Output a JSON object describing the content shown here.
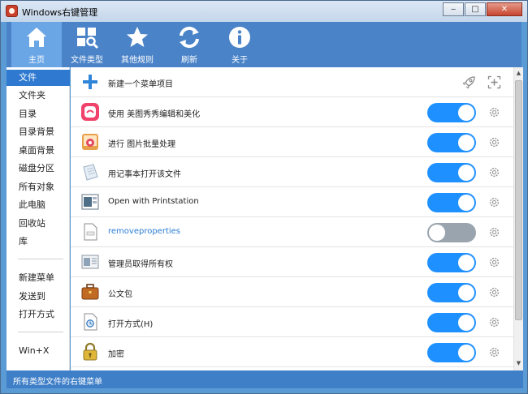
{
  "window": {
    "title": "Windows右键管理"
  },
  "colors": {
    "accent": "#2f7ad0",
    "toolbar": "#4a83c8",
    "toggle_on": "#1e90ff",
    "toggle_off": "#9aa4ae",
    "link": "#2b7cd3"
  },
  "toolbar": {
    "items": [
      {
        "label": "主页",
        "icon": "home-icon",
        "active": true
      },
      {
        "label": "文件类型",
        "icon": "file-types-icon",
        "active": false
      },
      {
        "label": "其他规则",
        "icon": "star-icon",
        "active": false
      },
      {
        "label": "刷新",
        "icon": "refresh-icon",
        "active": false
      },
      {
        "label": "关于",
        "icon": "info-icon",
        "active": false
      }
    ]
  },
  "sidebar": {
    "items": [
      {
        "label": "文件",
        "active": true
      },
      {
        "label": "文件夹"
      },
      {
        "label": "目录"
      },
      {
        "label": "目录背景"
      },
      {
        "label": "桌面背景"
      },
      {
        "label": "磁盘分区"
      },
      {
        "label": "所有对象"
      },
      {
        "label": "此电脑"
      },
      {
        "label": "回收站"
      },
      {
        "label": "库"
      },
      {
        "label": "新建菜单"
      },
      {
        "label": "发送到"
      },
      {
        "label": "打开方式"
      },
      {
        "label": "Win+X"
      }
    ]
  },
  "content": {
    "new_item_label": "新建一个菜单项目",
    "items": [
      {
        "label": "使用 美图秀秀编辑和美化",
        "icon": "meitu-icon",
        "enabled": true
      },
      {
        "label": "进行 图片批量处理",
        "icon": "batch-image-icon",
        "enabled": true
      },
      {
        "label": "用记事本打开该文件",
        "icon": "notepad-icon",
        "enabled": true
      },
      {
        "label": "Open with Printstation",
        "icon": "printstation-icon",
        "enabled": true
      },
      {
        "label": "removeproperties",
        "icon": "properties-icon",
        "enabled": false
      },
      {
        "label": "管理员取得所有权",
        "icon": "admin-icon",
        "enabled": true
      },
      {
        "label": "公文包",
        "icon": "briefcase-icon",
        "enabled": true
      },
      {
        "label": "打开方式(H)",
        "icon": "open-with-icon",
        "enabled": true
      },
      {
        "label": "加密",
        "icon": "lock-icon",
        "enabled": true
      }
    ]
  },
  "status": {
    "text": "所有类型文件的右键菜单"
  }
}
